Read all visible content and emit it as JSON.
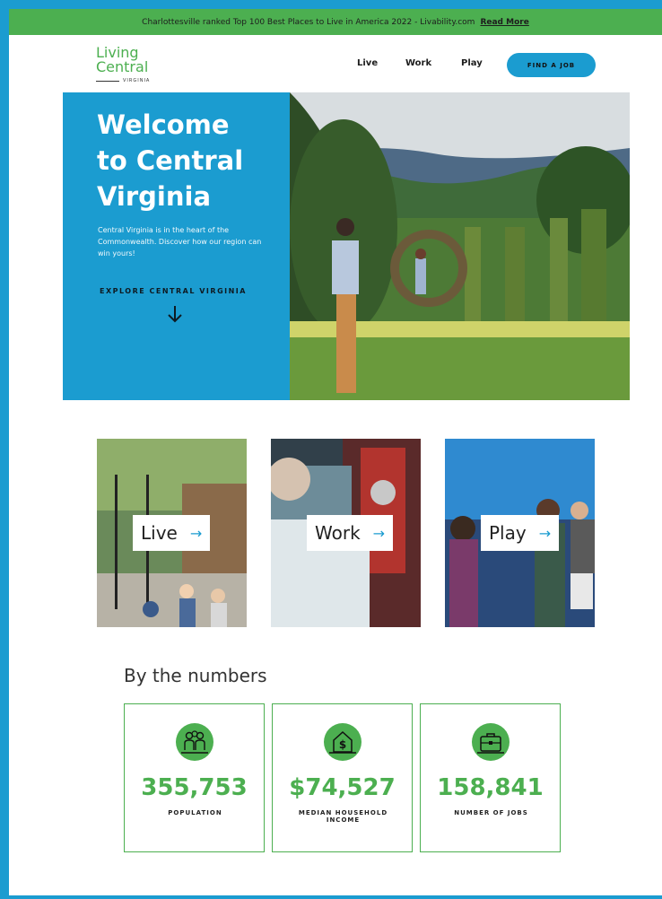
{
  "announcement": {
    "text": "Charlottesville ranked Top 100 Best Places to Live in America 2022 - Livability.com",
    "link": "Read More"
  },
  "logo": {
    "line1": "Living",
    "line2": "Central",
    "line3": "VIRGINIA"
  },
  "nav": {
    "items": [
      "Live",
      "Work",
      "Play"
    ],
    "cta": "FIND A JOB"
  },
  "hero": {
    "title": [
      "Welcome",
      "to Central",
      "Virginia"
    ],
    "description": "Central Virginia is in the heart of the Commonwealth. Discover how our region can win yours!",
    "explore": "EXPLORE CENTRAL VIRGINIA"
  },
  "cards": [
    {
      "label": "Live"
    },
    {
      "label": "Work"
    },
    {
      "label": "Play"
    }
  ],
  "numbers": {
    "title": "By the numbers",
    "stats": [
      {
        "value": "355,753",
        "label": "POPULATION",
        "icon": "people-icon"
      },
      {
        "value": "$74,527",
        "label": "MEDIAN HOUSEHOLD INCOME",
        "icon": "house-dollar-icon"
      },
      {
        "value": "158,841",
        "label": "NUMBER OF JOBS",
        "icon": "briefcase-icon"
      }
    ]
  },
  "colors": {
    "accent_blue": "#1b9cd0",
    "accent_green": "#4caf50"
  }
}
